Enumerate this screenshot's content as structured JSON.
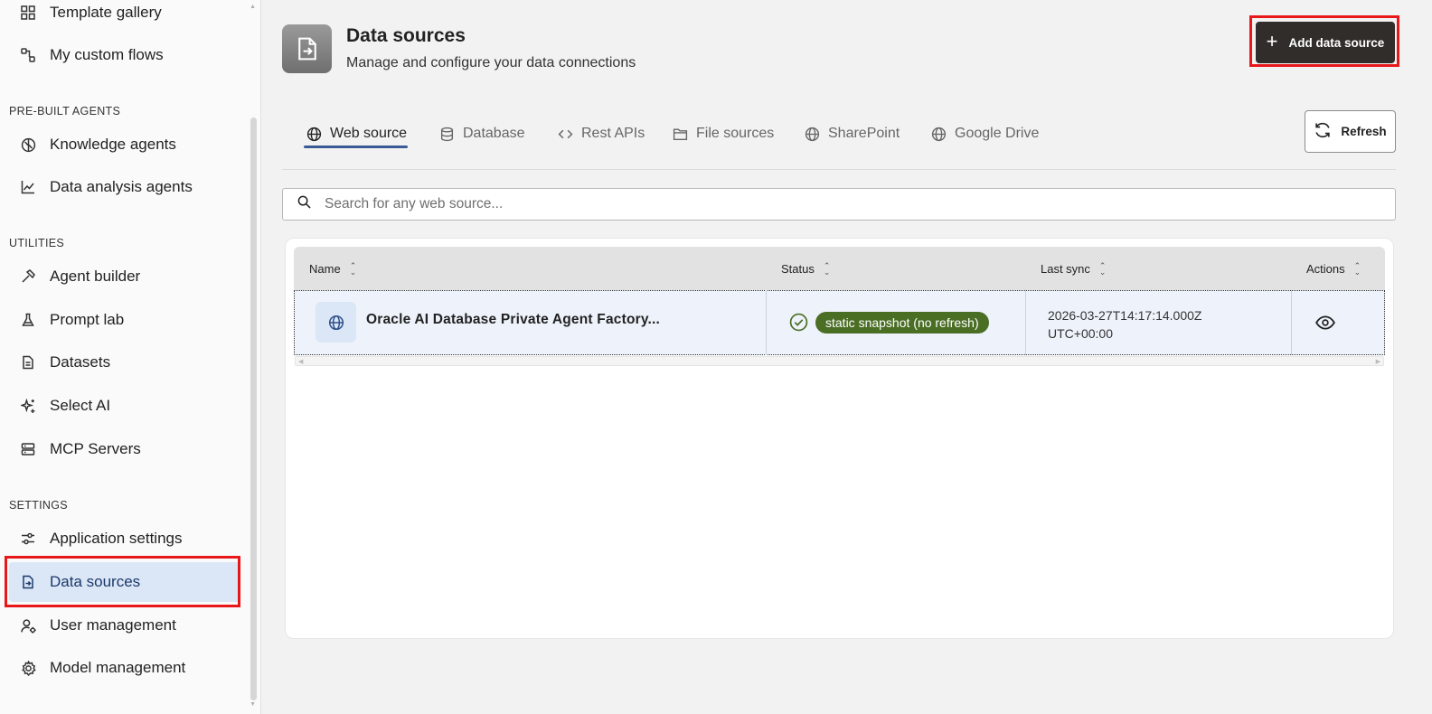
{
  "sidebar": {
    "items_top": [
      {
        "label": "Template gallery",
        "icon": "grid-icon"
      },
      {
        "label": "My custom flows",
        "icon": "flow-icon"
      }
    ],
    "sections": [
      {
        "title": "PRE-BUILT AGENTS",
        "items": [
          {
            "label": "Knowledge agents",
            "icon": "brain-icon"
          },
          {
            "label": "Data analysis agents",
            "icon": "chart-line-icon"
          }
        ]
      },
      {
        "title": "UTILITIES",
        "items": [
          {
            "label": "Agent builder",
            "icon": "hammer-icon"
          },
          {
            "label": "Prompt lab",
            "icon": "flask-icon"
          },
          {
            "label": "Datasets",
            "icon": "document-icon"
          },
          {
            "label": "Select AI",
            "icon": "sparkle-icon"
          },
          {
            "label": "MCP Servers",
            "icon": "server-icon"
          }
        ]
      },
      {
        "title": "SETTINGS",
        "items": [
          {
            "label": "Application settings",
            "icon": "sliders-icon"
          },
          {
            "label": "Data sources",
            "icon": "file-import-icon",
            "active": true
          },
          {
            "label": "User management",
            "icon": "user-gear-icon"
          },
          {
            "label": "Model management",
            "icon": "cog-icon"
          }
        ]
      }
    ]
  },
  "header": {
    "title": "Data sources",
    "subtitle": "Manage and configure your data connections",
    "add_button": "Add data source",
    "refresh_button": "Refresh"
  },
  "tabs": [
    {
      "label": "Web source",
      "icon": "globe-icon",
      "active": true
    },
    {
      "label": "Database",
      "icon": "database-icon"
    },
    {
      "label": "Rest APIs",
      "icon": "code-icon"
    },
    {
      "label": "File sources",
      "icon": "folder-icon"
    },
    {
      "label": "SharePoint",
      "icon": "globe-icon"
    },
    {
      "label": "Google Drive",
      "icon": "globe-icon"
    }
  ],
  "search": {
    "placeholder": "Search for any web source..."
  },
  "table": {
    "columns": [
      "Name",
      "Status",
      "Last sync",
      "Actions"
    ],
    "rows": [
      {
        "name": "Oracle AI Database Private Agent Factory...",
        "status": "static snapshot (no refresh)",
        "last_sync_line1": "2026-03-27T14:17:14.000Z",
        "last_sync_line2": "UTC+00:00"
      }
    ]
  },
  "colors": {
    "accent": "#312d2a",
    "active_nav": "#dbe6f6",
    "status_badge": "#4b6e25",
    "highlight": "#e8171a"
  }
}
